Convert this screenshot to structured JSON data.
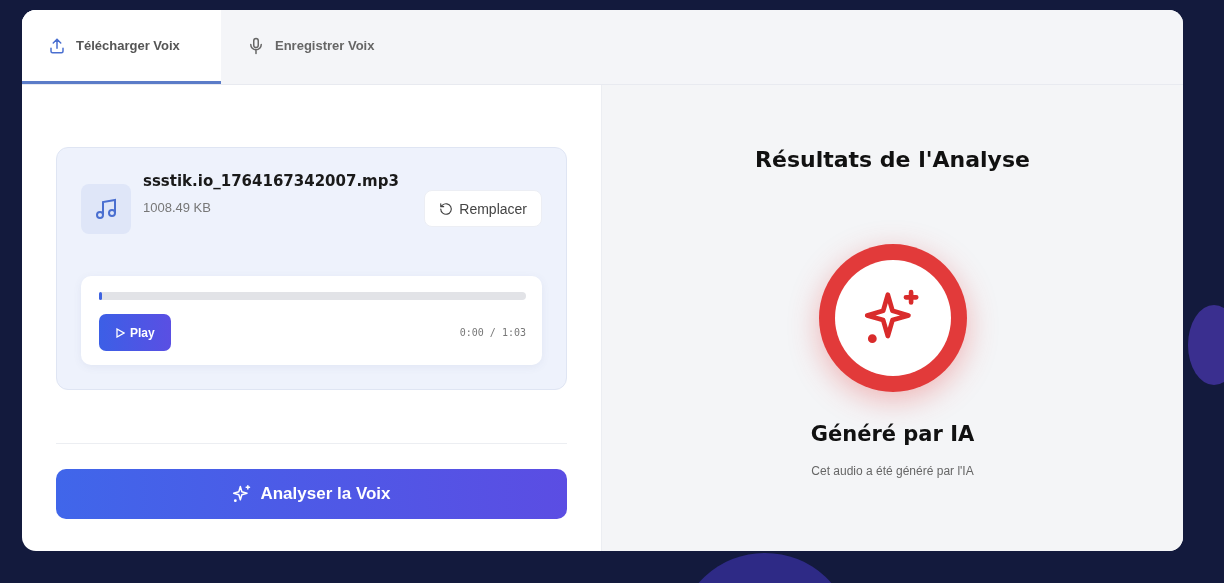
{
  "tabs": [
    {
      "label": "Télécharger Voix",
      "kind": "upload",
      "selected": true
    },
    {
      "label": "Enregistrer Voix",
      "kind": "mic",
      "selected": false
    }
  ],
  "file": {
    "name": "ssstik.io_1764167342007.mp3",
    "size": "1008.49 KB",
    "replace_label": "Remplacer"
  },
  "player": {
    "play_label": "Play",
    "time": "0:00 / 1:03",
    "level": 0.005
  },
  "analyze_button": "Analyser la Voix",
  "results": {
    "title": "Résultats de l'Analyse",
    "verdict": "Généré par IA",
    "description": "Cet audio a été généré par l'IA"
  }
}
